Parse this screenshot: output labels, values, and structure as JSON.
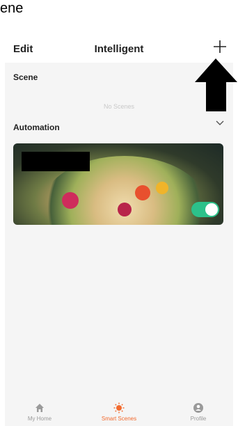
{
  "caption": "ene",
  "header": {
    "edit_label": "Edit",
    "title": "Intelligent"
  },
  "scene_section": {
    "label": "Scene",
    "empty_text": "No Scenes"
  },
  "automation_section": {
    "label": "Automation"
  },
  "automation_card": {
    "enabled": true
  },
  "tabbar": {
    "tabs": [
      {
        "label": "My Home",
        "icon": "home-icon",
        "active": false
      },
      {
        "label": "Smart Scenes",
        "icon": "sun-icon",
        "active": true
      },
      {
        "label": "Profile",
        "icon": "profile-icon",
        "active": false
      }
    ]
  },
  "colors": {
    "accent": "#f26a2e",
    "toggle_on": "#2cc18a"
  }
}
